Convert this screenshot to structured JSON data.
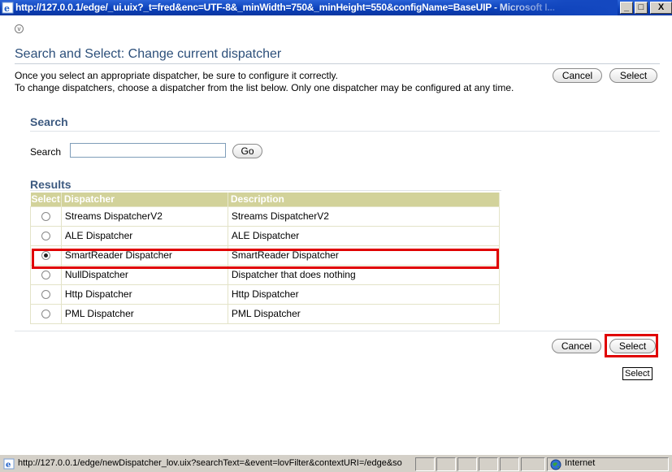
{
  "window": {
    "title": "http://127.0.0.1/edge/_ui.uix?_t=fred&enc=UTF-8&_minWidth=750&_minHeight=550&configName=BaseUIP - Microsoft I...",
    "minimize_label": "_",
    "maximize_label": "□",
    "close_label": "X"
  },
  "page": {
    "title": "Search and Select: Change current dispatcher",
    "instructions_line1": "Once you select an appropriate dispatcher, be sure to configure it correctly.",
    "instructions_line2": "To change dispatchers, choose a dispatcher from the list below. Only one dispatcher may be configured at any time.",
    "cancel_label": "Cancel",
    "select_label": "Select"
  },
  "search": {
    "section_title": "Search",
    "label": "Search",
    "value": "",
    "go_label": "Go"
  },
  "results": {
    "section_title": "Results",
    "columns": [
      "Select",
      "Dispatcher",
      "Description"
    ],
    "rows": [
      {
        "dispatcher": "Streams DispatcherV2",
        "description": "Streams DispatcherV2",
        "selected": false
      },
      {
        "dispatcher": "ALE Dispatcher",
        "description": "ALE Dispatcher",
        "selected": false
      },
      {
        "dispatcher": "SmartReader Dispatcher",
        "description": "SmartReader Dispatcher",
        "selected": true
      },
      {
        "dispatcher": "NullDispatcher",
        "description": "Dispatcher that does nothing",
        "selected": false
      },
      {
        "dispatcher": "Http Dispatcher",
        "description": "Http Dispatcher",
        "selected": false
      },
      {
        "dispatcher": "PML Dispatcher",
        "description": "PML Dispatcher",
        "selected": false
      }
    ]
  },
  "footer": {
    "cancel_label": "Cancel",
    "select_label": "Select",
    "tooltip": "Select"
  },
  "statusbar": {
    "url": "http://127.0.0.1/edge/newDispatcher_lov.uix?searchText=&event=lovFilter&contextURI=/edge&so",
    "zone": "Internet"
  },
  "colors": {
    "title_bar": "#0a3fb8",
    "heading": "#2c4f7a",
    "table_header": "#d2d29a",
    "highlight": "#e00000"
  },
  "icons": [
    "ie-page-icon",
    "collapse-icon",
    "internet-zone-icon"
  ]
}
